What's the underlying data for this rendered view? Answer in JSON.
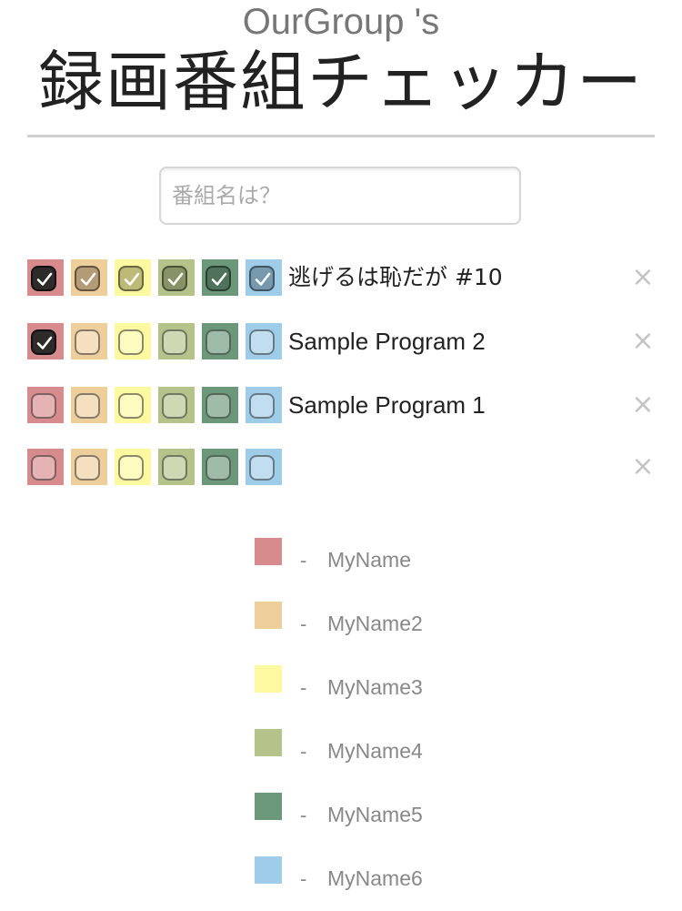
{
  "header": {
    "subtitle": "OurGroup 's",
    "title": "録画番組チェッカー"
  },
  "search": {
    "placeholder": "番組名は？",
    "value": ""
  },
  "members": [
    {
      "name": "MyName",
      "color": "#d78b8c"
    },
    {
      "name": "MyName2",
      "color": "#eecf9c"
    },
    {
      "name": "MyName3",
      "color": "#fdf9a0"
    },
    {
      "name": "MyName4",
      "color": "#b4c38a"
    },
    {
      "name": "MyName5",
      "color": "#6a9878"
    },
    {
      "name": "MyName6",
      "color": "#9fcce9"
    }
  ],
  "programs": [
    {
      "title": "逃げるは恥だが #10",
      "checked": [
        true,
        true,
        true,
        true,
        true,
        true
      ],
      "delete_label": "×"
    },
    {
      "title": "Sample Program 2",
      "checked": [
        true,
        false,
        false,
        false,
        false,
        false
      ],
      "delete_label": "×"
    },
    {
      "title": "Sample Program 1",
      "checked": [
        false,
        false,
        false,
        false,
        false,
        false
      ],
      "delete_label": "×"
    },
    {
      "title": "",
      "checked": [
        false,
        false,
        false,
        false,
        false,
        false
      ],
      "delete_label": "×"
    }
  ],
  "legend": {
    "separator": "-"
  }
}
